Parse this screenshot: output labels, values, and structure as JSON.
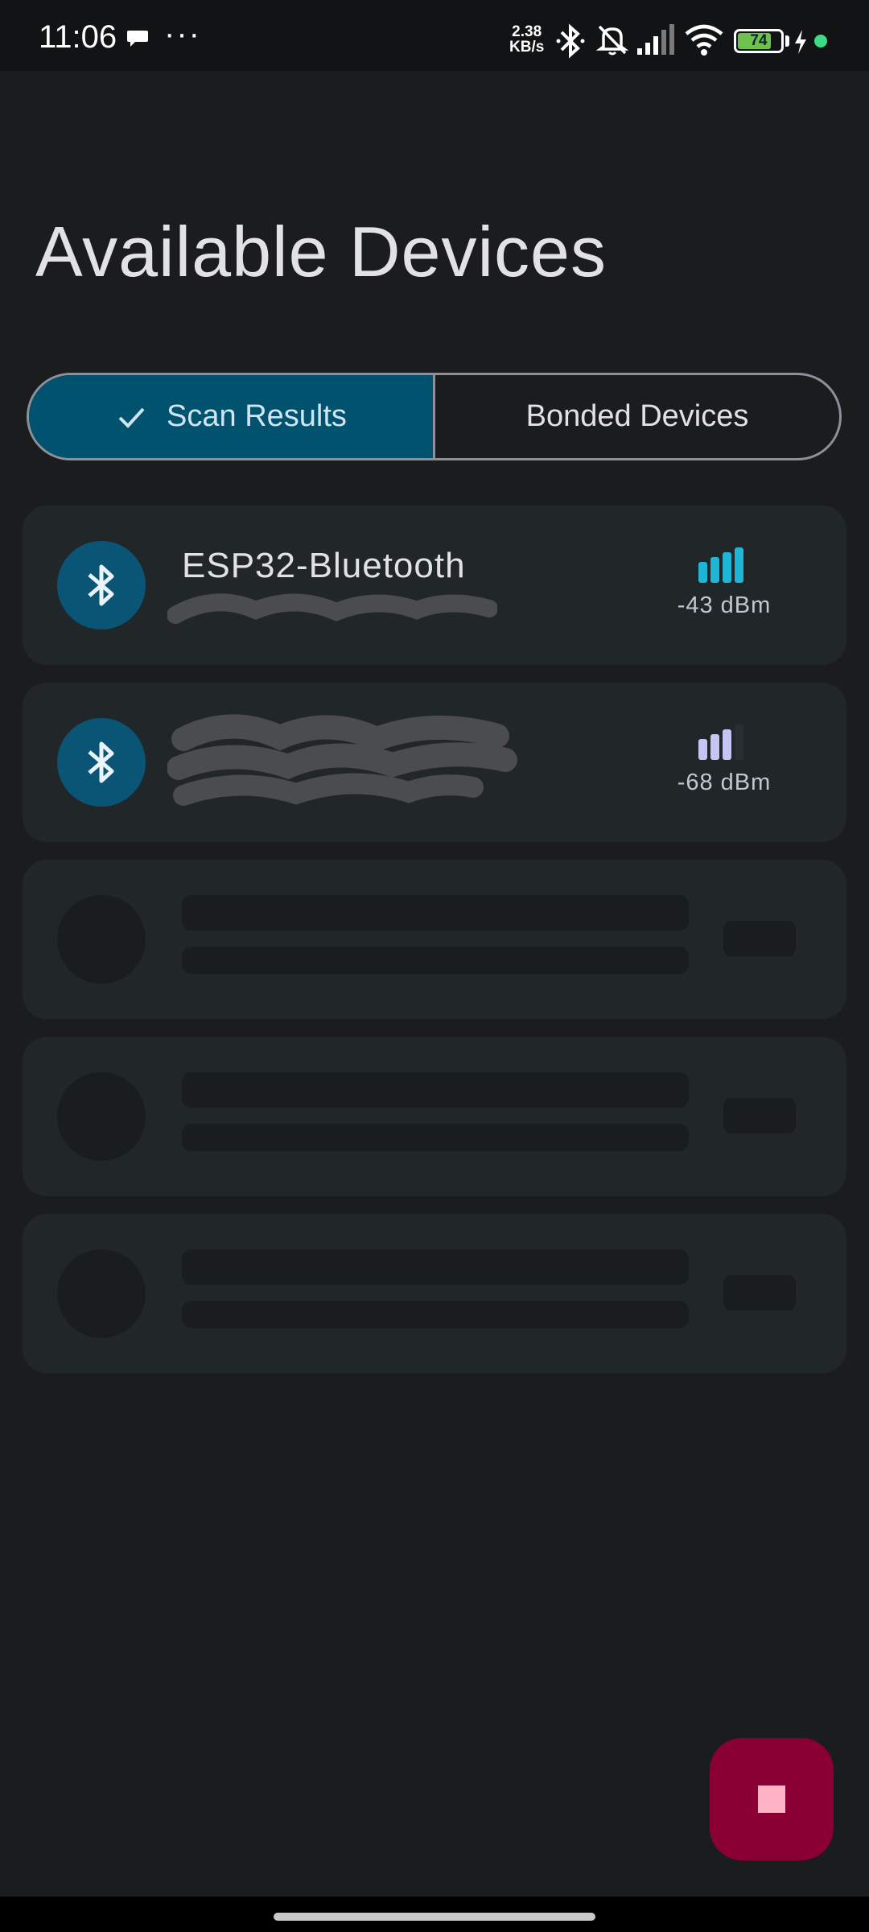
{
  "status_bar": {
    "time": "11:06",
    "dots": "···",
    "net_speed_value": "2.38",
    "net_speed_unit": "KB/s",
    "battery": "74"
  },
  "header": {
    "title": "Available Devices"
  },
  "tabs": [
    {
      "label": "Scan Results",
      "selected": true
    },
    {
      "label": "Bonded Devices",
      "selected": false
    }
  ],
  "devices": [
    {
      "name": "ESP32-Bluetooth",
      "rssi": "-43 dBm",
      "signal_bars": 4,
      "signal_color": "#1fb5d6"
    },
    {
      "name": "",
      "rssi": "-68 dBm",
      "signal_bars": 3,
      "signal_color": "#c7c3f2"
    }
  ],
  "colors": {
    "accent": "#00526e",
    "fab": "#8b0034"
  },
  "fab": {
    "icon": "stop-icon"
  }
}
